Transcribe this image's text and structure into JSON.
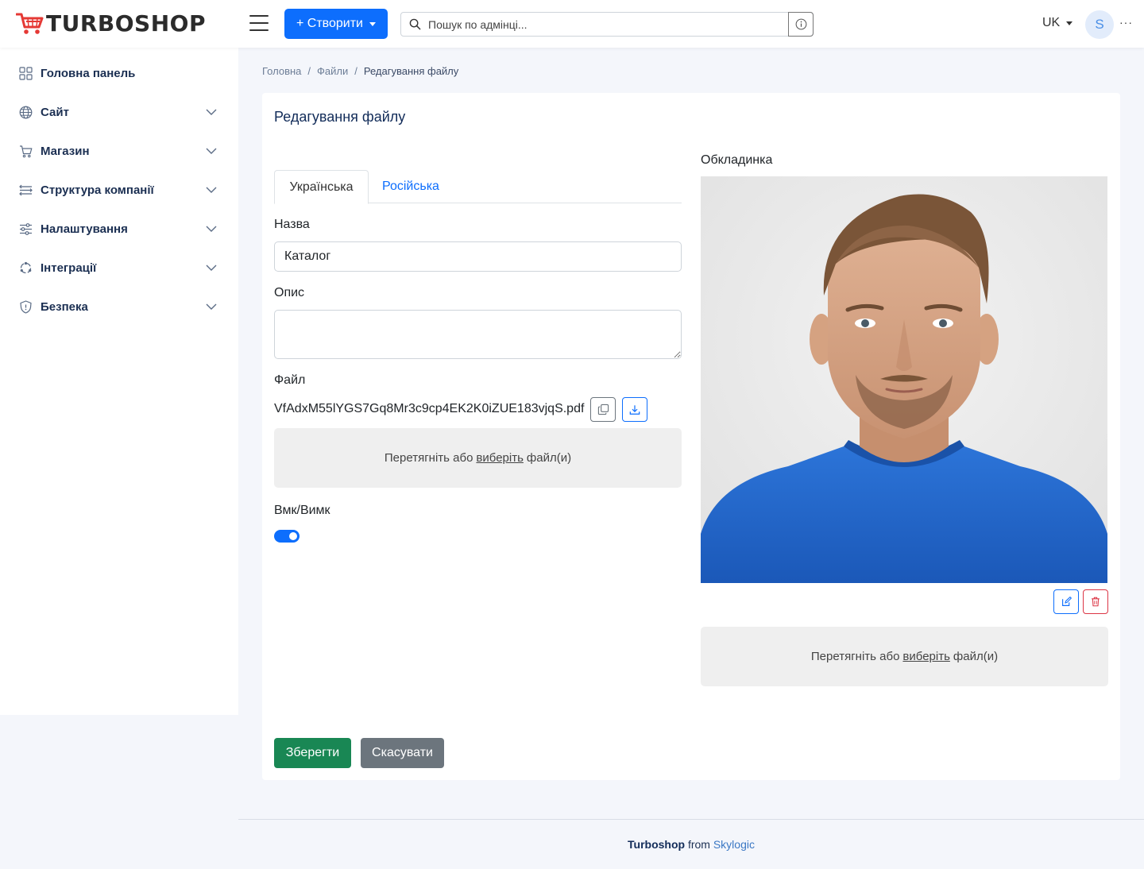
{
  "header": {
    "logo_text": "TURBOSHOP",
    "create_label": "+ Створити",
    "search_placeholder": "Пошук по адмінці...",
    "language": "UK",
    "avatar_initial": "S",
    "more": "···"
  },
  "sidebar": {
    "items": [
      {
        "label": "Головна панель",
        "icon": "dashboard-icon"
      },
      {
        "label": "Сайт",
        "icon": "globe-icon"
      },
      {
        "label": "Магазин",
        "icon": "cart-icon"
      },
      {
        "label": "Структура компанії",
        "icon": "structure-icon"
      },
      {
        "label": "Налаштування",
        "icon": "sliders-icon"
      },
      {
        "label": "Інтеграції",
        "icon": "integrations-icon"
      },
      {
        "label": "Безпека",
        "icon": "shield-icon"
      }
    ]
  },
  "breadcrumb": [
    "Головна",
    "Файли",
    "Редагування файлу"
  ],
  "form": {
    "title": "Редагування файлу",
    "tabs": [
      "Українська",
      "Російська"
    ],
    "name_label": "Назва",
    "name_value": "Каталог",
    "description_label": "Опис",
    "description_value": "",
    "file_label": "Файл",
    "file_name": "VfAdxM55lYGS7Gq8Mr3c9cp4EK2K0iZUE183vjqS.pdf",
    "drop_text_before": "Перетягніть або",
    "drop_link": "виберіть",
    "drop_text_after": "файл(и)",
    "toggle_label": "Вмк/Вимк",
    "toggle_on": true,
    "cover_label": "Обкладинка",
    "save_label": "Зберегти",
    "cancel_label": "Скасувати"
  },
  "footer": {
    "brand": "Turboshop",
    "from": "from",
    "company": "Skylogic"
  },
  "colors": {
    "primary": "#0d6efd",
    "success": "#198754",
    "secondary": "#6c757d",
    "danger": "#dc3545",
    "sidebar_text": "#1b2f52"
  }
}
